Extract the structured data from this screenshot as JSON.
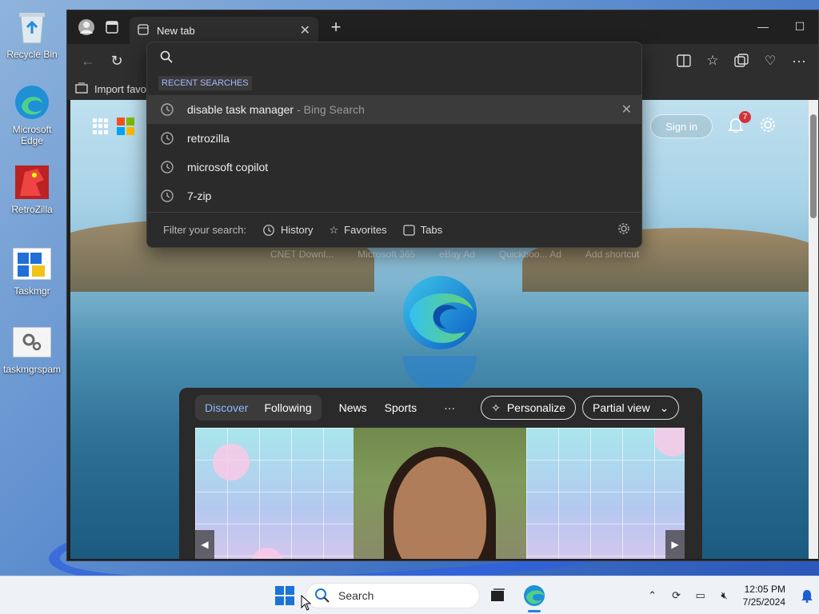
{
  "desktop": {
    "icons": [
      {
        "label": "Recycle Bin",
        "icon": "recycle-bin-icon"
      },
      {
        "label": "Microsoft Edge",
        "icon": "edge-icon"
      },
      {
        "label": "RetroZilla",
        "icon": "retrozilla-icon"
      },
      {
        "label": "Taskmgr",
        "icon": "taskmgr-icon"
      },
      {
        "label": "taskmgrspam",
        "icon": "gear-file-icon"
      }
    ]
  },
  "browser": {
    "tab_title": "New tab",
    "favbar_label": "Import favo",
    "page": {
      "signin_label": "Sign in",
      "notification_count": "7",
      "shortcuts": [
        "CNET Downl...",
        "Microsoft 365",
        "eBay Ad",
        "Quickboo... Ad",
        "Add shortcut"
      ]
    },
    "feed": {
      "tabs": [
        "Discover",
        "Following"
      ],
      "links": [
        "News",
        "Sports"
      ],
      "more": "···",
      "personalize_label": "Personalize",
      "view_label": "Partial view"
    }
  },
  "dropdown": {
    "search_placeholder": "",
    "header": "RECENT SEARCHES",
    "items": [
      {
        "text": "disable task manager",
        "suffix": "- Bing Search"
      },
      {
        "text": "retrozilla",
        "suffix": ""
      },
      {
        "text": "microsoft copilot",
        "suffix": ""
      },
      {
        "text": "7-zip",
        "suffix": ""
      }
    ],
    "filter_label": "Filter your search:",
    "filters": [
      "History",
      "Favorites",
      "Tabs"
    ]
  },
  "taskbar": {
    "search_label": "Search",
    "time": "12:05 PM",
    "date": "7/25/2024"
  },
  "colors": {
    "accent": "#2b7de9",
    "badge": "#d13438",
    "dropdown_bg": "#2b2b2b"
  }
}
